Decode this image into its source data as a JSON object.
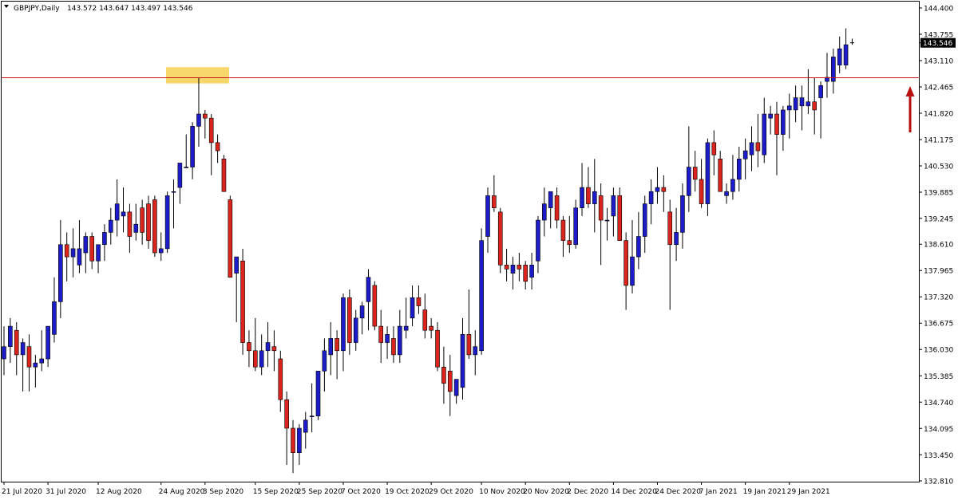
{
  "header": {
    "symbol": "GBPJPY,Daily",
    "ohlc": "143.572 143.647 143.497 143.546"
  },
  "price_tag": "143.546",
  "colors": {
    "bull_body": "#1c1cc8",
    "bear_body": "#d9251d",
    "wick": "#000000",
    "resistance_line": "#c81414",
    "highlight": "#f7d66a",
    "arrow": "#b80f0f",
    "price_tag_bg": "#000000",
    "price_tag_fg": "#ffffff"
  },
  "chart_data": {
    "type": "candlestick",
    "title": "GBPJPY,Daily",
    "ylim": [
      132.68,
      144.6
    ],
    "y_ticks": [
      "144.400",
      "143.755",
      "143.110",
      "142.465",
      "141.820",
      "141.175",
      "140.530",
      "139.885",
      "139.245",
      "138.610",
      "137.965",
      "137.320",
      "136.675",
      "136.030",
      "135.385",
      "134.740",
      "134.095",
      "133.450",
      "132.810"
    ],
    "x_ticks": [
      "21 Jul 2020",
      "31 Jul 2020",
      "12 Aug 2020",
      "24 Aug 2020",
      "3 Sep 2020",
      "15 Sep 2020",
      "25 Sep 2020",
      "7 Oct 2020",
      "19 Oct 2020",
      "29 Oct 2020",
      "10 Nov 2020",
      "20 Nov 2020",
      "2 Dec 2020",
      "14 Dec 2020",
      "24 Dec 2020",
      "7 Jan 2021",
      "19 Jan 2021",
      "29 Jan 2021"
    ],
    "resistance_level": 142.69,
    "highlight_zone": [
      142.55,
      142.95
    ],
    "last_price": 143.546,
    "candles": [
      {
        "x": "21 Jul 2020",
        "o": 135.8,
        "h": 136.6,
        "l": 135.4,
        "c": 136.1
      },
      {
        "o": 136.1,
        "h": 136.8,
        "l": 135.7,
        "c": 136.6
      },
      {
        "o": 136.5,
        "h": 136.7,
        "l": 135.4,
        "c": 135.9
      },
      {
        "o": 135.9,
        "h": 136.3,
        "l": 135.0,
        "c": 136.2
      },
      {
        "o": 136.1,
        "h": 136.4,
        "l": 135.0,
        "c": 135.6
      },
      {
        "o": 135.6,
        "h": 135.9,
        "l": 135.1,
        "c": 135.7
      },
      {
        "o": 135.7,
        "h": 136.5,
        "l": 135.5,
        "c": 135.8
      },
      {
        "x": "31 Jul 2020",
        "o": 135.8,
        "h": 136.6,
        "l": 135.6,
        "c": 136.6
      },
      {
        "o": 136.4,
        "h": 137.8,
        "l": 136.2,
        "c": 137.2
      },
      {
        "o": 137.2,
        "h": 139.2,
        "l": 136.8,
        "c": 138.6
      },
      {
        "o": 138.6,
        "h": 138.9,
        "l": 137.7,
        "c": 138.3
      },
      {
        "o": 138.3,
        "h": 139.0,
        "l": 137.8,
        "c": 138.5
      },
      {
        "o": 138.1,
        "h": 139.2,
        "l": 137.9,
        "c": 138.5
      },
      {
        "o": 138.4,
        "h": 138.9,
        "l": 137.9,
        "c": 138.8
      },
      {
        "o": 138.8,
        "h": 138.9,
        "l": 138.0,
        "c": 138.2
      },
      {
        "x": "12 Aug 2020",
        "o": 138.2,
        "h": 138.6,
        "l": 137.9,
        "c": 138.6
      },
      {
        "o": 138.6,
        "h": 139.1,
        "l": 138.2,
        "c": 138.9
      },
      {
        "o": 138.9,
        "h": 139.5,
        "l": 138.6,
        "c": 139.2
      },
      {
        "o": 139.2,
        "h": 140.2,
        "l": 138.8,
        "c": 139.6
      },
      {
        "o": 139.3,
        "h": 140.0,
        "l": 138.9,
        "c": 139.4
      },
      {
        "o": 139.4,
        "h": 139.6,
        "l": 138.4,
        "c": 138.8
      },
      {
        "o": 138.9,
        "h": 139.6,
        "l": 138.7,
        "c": 139.1
      },
      {
        "o": 139.5,
        "h": 139.7,
        "l": 138.6,
        "c": 138.9
      },
      {
        "o": 139.6,
        "h": 139.8,
        "l": 138.5,
        "c": 138.7
      },
      {
        "o": 139.7,
        "h": 139.8,
        "l": 138.3,
        "c": 138.4
      },
      {
        "x": "24 Aug 2020",
        "o": 138.4,
        "h": 138.9,
        "l": 138.2,
        "c": 138.5
      },
      {
        "o": 138.5,
        "h": 139.9,
        "l": 138.4,
        "c": 139.8
      },
      {
        "o": 139.9,
        "h": 140.2,
        "l": 139.0,
        "c": 139.9
      },
      {
        "o": 140.0,
        "h": 140.6,
        "l": 139.6,
        "c": 140.6
      },
      {
        "o": 140.5,
        "h": 141.3,
        "l": 140.5,
        "c": 140.5
      },
      {
        "o": 140.5,
        "h": 141.6,
        "l": 140.2,
        "c": 141.5
      },
      {
        "o": 141.5,
        "h": 142.7,
        "l": 141.0,
        "c": 141.8
      },
      {
        "x": "3 Sep 2020",
        "o": 141.8,
        "h": 141.9,
        "l": 141.2,
        "c": 141.7
      },
      {
        "o": 141.7,
        "h": 141.8,
        "l": 140.3,
        "c": 141.1
      },
      {
        "o": 141.1,
        "h": 141.3,
        "l": 140.6,
        "c": 140.9
      },
      {
        "o": 140.7,
        "h": 140.8,
        "l": 139.9,
        "c": 139.9
      },
      {
        "o": 139.7,
        "h": 139.8,
        "l": 137.8,
        "c": 137.8
      },
      {
        "o": 137.9,
        "h": 138.3,
        "l": 136.7,
        "c": 138.3
      },
      {
        "o": 138.2,
        "h": 138.5,
        "l": 135.9,
        "c": 136.2
      },
      {
        "o": 136.2,
        "h": 136.5,
        "l": 135.6,
        "c": 136.0
      },
      {
        "x": "15 Sep 2020",
        "o": 136.0,
        "h": 136.8,
        "l": 135.5,
        "c": 135.6
      },
      {
        "o": 135.6,
        "h": 136.4,
        "l": 135.4,
        "c": 136.0
      },
      {
        "o": 136.0,
        "h": 136.7,
        "l": 135.6,
        "c": 136.2
      },
      {
        "o": 136.1,
        "h": 136.5,
        "l": 135.5,
        "c": 136.0
      },
      {
        "o": 135.8,
        "h": 136.0,
        "l": 134.5,
        "c": 134.8
      },
      {
        "o": 134.8,
        "h": 135.0,
        "l": 133.2,
        "c": 134.1
      },
      {
        "o": 134.1,
        "h": 134.3,
        "l": 133.0,
        "c": 133.5
      },
      {
        "x": "25 Sep 2020",
        "o": 133.5,
        "h": 134.2,
        "l": 133.2,
        "c": 134.1
      },
      {
        "o": 134.0,
        "h": 134.5,
        "l": 133.6,
        "c": 134.3
      },
      {
        "o": 134.4,
        "h": 135.2,
        "l": 134.0,
        "c": 134.4
      },
      {
        "o": 134.4,
        "h": 135.5,
        "l": 134.3,
        "c": 135.5
      },
      {
        "o": 135.5,
        "h": 136.3,
        "l": 135.0,
        "c": 136.0
      },
      {
        "o": 135.9,
        "h": 136.7,
        "l": 135.4,
        "c": 136.3
      },
      {
        "o": 136.3,
        "h": 136.5,
        "l": 135.3,
        "c": 136.0
      },
      {
        "x": "7 Oct 2020",
        "o": 136.0,
        "h": 137.4,
        "l": 135.5,
        "c": 137.3
      },
      {
        "o": 137.3,
        "h": 137.5,
        "l": 135.9,
        "c": 136.2
      },
      {
        "o": 136.2,
        "h": 137.0,
        "l": 136.0,
        "c": 136.8
      },
      {
        "o": 136.8,
        "h": 137.2,
        "l": 136.4,
        "c": 137.1
      },
      {
        "o": 137.2,
        "h": 138.0,
        "l": 136.5,
        "c": 137.8
      },
      {
        "o": 137.6,
        "h": 137.7,
        "l": 136.5,
        "c": 136.6
      },
      {
        "o": 136.6,
        "h": 137.0,
        "l": 135.7,
        "c": 136.2
      },
      {
        "x": "19 Oct 2020",
        "o": 136.2,
        "h": 136.6,
        "l": 135.8,
        "c": 136.4
      },
      {
        "o": 136.3,
        "h": 136.6,
        "l": 135.7,
        "c": 135.9
      },
      {
        "o": 135.9,
        "h": 137.0,
        "l": 135.7,
        "c": 136.6
      },
      {
        "o": 136.5,
        "h": 137.3,
        "l": 136.3,
        "c": 136.6
      },
      {
        "o": 136.8,
        "h": 137.6,
        "l": 136.6,
        "c": 137.3
      },
      {
        "o": 137.3,
        "h": 137.6,
        "l": 136.9,
        "c": 137.1
      },
      {
        "o": 137.0,
        "h": 137.4,
        "l": 136.3,
        "c": 136.5
      },
      {
        "x": "29 Oct 2020",
        "o": 136.6,
        "h": 136.8,
        "l": 136.3,
        "c": 136.5
      },
      {
        "o": 136.5,
        "h": 136.7,
        "l": 135.5,
        "c": 135.6
      },
      {
        "o": 135.6,
        "h": 136.1,
        "l": 134.7,
        "c": 135.2
      },
      {
        "o": 135.5,
        "h": 135.9,
        "l": 134.4,
        "c": 135.0
      },
      {
        "o": 134.9,
        "h": 135.3,
        "l": 134.7,
        "c": 135.3
      },
      {
        "o": 135.1,
        "h": 136.8,
        "l": 134.8,
        "c": 136.4
      },
      {
        "o": 136.4,
        "h": 137.5,
        "l": 135.8,
        "c": 135.9
      },
      {
        "o": 135.9,
        "h": 136.5,
        "l": 135.4,
        "c": 136.1
      },
      {
        "x": "10 Nov 2020",
        "o": 136.0,
        "h": 139.0,
        "l": 135.9,
        "c": 138.7
      },
      {
        "o": 138.8,
        "h": 140.0,
        "l": 138.4,
        "c": 139.8
      },
      {
        "o": 139.8,
        "h": 140.3,
        "l": 139.4,
        "c": 139.5
      },
      {
        "o": 139.4,
        "h": 139.5,
        "l": 137.9,
        "c": 138.1
      },
      {
        "o": 138.1,
        "h": 138.5,
        "l": 137.7,
        "c": 138.0
      },
      {
        "o": 137.9,
        "h": 138.3,
        "l": 137.5,
        "c": 138.1
      },
      {
        "o": 138.1,
        "h": 138.4,
        "l": 137.7,
        "c": 138.0
      },
      {
        "x": "20 Nov 2020",
        "o": 138.1,
        "h": 138.2,
        "l": 137.5,
        "c": 137.7
      },
      {
        "o": 137.8,
        "h": 138.4,
        "l": 137.5,
        "c": 138.1
      },
      {
        "o": 138.2,
        "h": 139.3,
        "l": 137.9,
        "c": 139.2
      },
      {
        "o": 139.2,
        "h": 140.0,
        "l": 138.8,
        "c": 139.6
      },
      {
        "o": 139.5,
        "h": 139.9,
        "l": 139.0,
        "c": 139.9
      },
      {
        "o": 139.8,
        "h": 140.0,
        "l": 139.0,
        "c": 139.2
      },
      {
        "o": 139.2,
        "h": 139.3,
        "l": 138.3,
        "c": 138.7
      },
      {
        "x": "2 Dec 2020",
        "o": 138.7,
        "h": 139.3,
        "l": 138.4,
        "c": 138.6
      },
      {
        "o": 138.6,
        "h": 139.7,
        "l": 138.5,
        "c": 139.5
      },
      {
        "o": 139.5,
        "h": 140.6,
        "l": 139.3,
        "c": 140.0
      },
      {
        "o": 140.0,
        "h": 140.5,
        "l": 139.5,
        "c": 139.6
      },
      {
        "o": 139.6,
        "h": 140.7,
        "l": 138.9,
        "c": 139.9
      },
      {
        "o": 139.8,
        "h": 140.1,
        "l": 138.1,
        "c": 139.2
      },
      {
        "o": 139.2,
        "h": 139.5,
        "l": 138.7,
        "c": 139.2
      },
      {
        "x": "14 Dec 2020",
        "o": 139.3,
        "h": 140.0,
        "l": 138.8,
        "c": 139.8
      },
      {
        "o": 139.8,
        "h": 140.0,
        "l": 138.9,
        "c": 138.7
      },
      {
        "o": 138.7,
        "h": 138.9,
        "l": 137.0,
        "c": 137.6
      },
      {
        "o": 137.6,
        "h": 139.2,
        "l": 137.4,
        "c": 138.3
      },
      {
        "o": 138.3,
        "h": 139.4,
        "l": 138.0,
        "c": 138.8
      },
      {
        "o": 138.8,
        "h": 139.8,
        "l": 138.4,
        "c": 139.6
      },
      {
        "o": 139.6,
        "h": 140.2,
        "l": 139.1,
        "c": 139.9
      },
      {
        "x": "24 Dec 2020",
        "o": 139.9,
        "h": 140.5,
        "l": 139.6,
        "c": 140.0
      },
      {
        "o": 140.0,
        "h": 140.3,
        "l": 139.4,
        "c": 139.9
      },
      {
        "o": 139.4,
        "h": 139.7,
        "l": 137.0,
        "c": 138.6
      },
      {
        "o": 138.6,
        "h": 139.5,
        "l": 138.2,
        "c": 138.9
      },
      {
        "o": 138.9,
        "h": 140.1,
        "l": 138.5,
        "c": 139.8
      },
      {
        "o": 139.8,
        "h": 141.5,
        "l": 139.4,
        "c": 140.5
      },
      {
        "o": 140.5,
        "h": 140.9,
        "l": 139.9,
        "c": 140.2
      },
      {
        "x": "7 Jan 2021",
        "o": 140.2,
        "h": 140.7,
        "l": 139.5,
        "c": 139.6
      },
      {
        "o": 139.6,
        "h": 141.2,
        "l": 139.3,
        "c": 141.1
      },
      {
        "o": 141.1,
        "h": 141.4,
        "l": 140.3,
        "c": 140.8
      },
      {
        "o": 140.7,
        "h": 140.9,
        "l": 139.9,
        "c": 139.9
      },
      {
        "o": 139.8,
        "h": 140.1,
        "l": 139.6,
        "c": 139.9
      },
      {
        "o": 139.9,
        "h": 140.8,
        "l": 139.7,
        "c": 140.2
      },
      {
        "o": 140.2,
        "h": 141.0,
        "l": 139.9,
        "c": 140.7
      },
      {
        "x": "19 Jan 2021",
        "o": 140.7,
        "h": 141.2,
        "l": 140.2,
        "c": 140.9
      },
      {
        "o": 140.8,
        "h": 141.5,
        "l": 140.4,
        "c": 141.1
      },
      {
        "o": 141.1,
        "h": 141.8,
        "l": 140.5,
        "c": 140.9
      },
      {
        "o": 140.8,
        "h": 142.2,
        "l": 140.6,
        "c": 141.8
      },
      {
        "o": 141.7,
        "h": 142.0,
        "l": 141.3,
        "c": 141.8
      },
      {
        "o": 141.8,
        "h": 142.1,
        "l": 140.3,
        "c": 141.3
      },
      {
        "o": 141.3,
        "h": 142.0,
        "l": 140.9,
        "c": 141.9
      },
      {
        "x": "29 Jan 2021",
        "o": 141.9,
        "h": 142.3,
        "l": 141.2,
        "c": 142.0
      },
      {
        "o": 141.9,
        "h": 142.5,
        "l": 141.6,
        "c": 142.2
      },
      {
        "o": 142.0,
        "h": 142.5,
        "l": 141.4,
        "c": 142.2
      },
      {
        "o": 142.0,
        "h": 142.9,
        "l": 141.8,
        "c": 142.1
      },
      {
        "o": 142.1,
        "h": 142.7,
        "l": 141.3,
        "c": 141.9
      },
      {
        "o": 142.2,
        "h": 142.6,
        "l": 141.2,
        "c": 142.5
      },
      {
        "o": 142.6,
        "h": 143.3,
        "l": 142.2,
        "c": 142.7
      },
      {
        "o": 142.6,
        "h": 143.4,
        "l": 142.3,
        "c": 143.2
      },
      {
        "o": 143.0,
        "h": 143.7,
        "l": 142.8,
        "c": 143.4
      },
      {
        "o": 143.0,
        "h": 143.9,
        "l": 142.9,
        "c": 143.5
      },
      {
        "o": 143.572,
        "h": 143.647,
        "l": 143.497,
        "c": 143.546
      }
    ]
  }
}
